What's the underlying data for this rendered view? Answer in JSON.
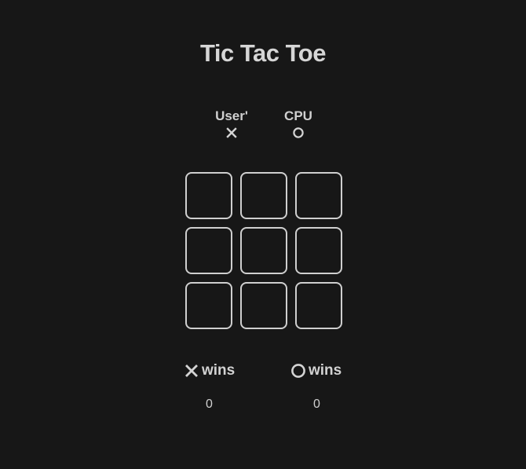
{
  "title": "Tic Tac Toe",
  "players": {
    "user": {
      "name": "User'",
      "mark_icon": "x-icon"
    },
    "cpu": {
      "name": "CPU",
      "mark_icon": "circle-icon"
    }
  },
  "board": {
    "cells": [
      "",
      "",
      "",
      "",
      "",
      "",
      "",
      "",
      ""
    ]
  },
  "scores": {
    "x": {
      "icon": "x-icon",
      "label": "wins",
      "value": "0"
    },
    "o": {
      "icon": "circle-icon",
      "label": "wins",
      "value": "0"
    }
  },
  "colors": {
    "background": "#171717",
    "foreground": "#d4d4d4",
    "cell_border": "#cfcfcf"
  }
}
